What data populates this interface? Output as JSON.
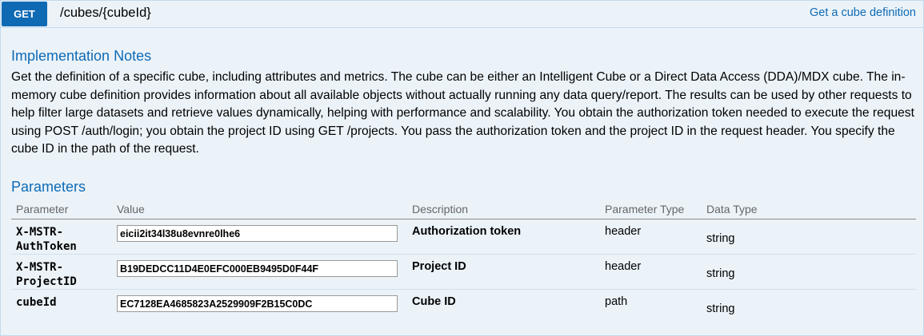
{
  "endpoint": {
    "method": "GET",
    "path": "/cubes/{cubeId}",
    "summary": "Get a cube definition"
  },
  "implementation_notes": {
    "title": "Implementation Notes",
    "body": "Get the definition of a specific cube, including attributes and metrics. The cube can be either an Intelligent Cube or a Direct Data Access (DDA)/MDX cube. The in-memory cube definition provides information about all available objects without actually running any data query/report. The results can be used by other requests to help filter large datasets and retrieve values dynamically, helping with performance and scalability. You obtain the authorization token needed to execute the request using POST /auth/login; you obtain the project ID using GET /projects. You pass the authorization token and the project ID in the request header. You specify the cube ID in the path of the request."
  },
  "parameters": {
    "title": "Parameters",
    "columns": [
      "Parameter",
      "Value",
      "Description",
      "Parameter Type",
      "Data Type"
    ],
    "rows": [
      {
        "name": "X-MSTR-AuthToken",
        "name_line1": "X-MSTR-",
        "name_line2": "AuthToken",
        "value": "eicii2it34l38u8evnre0lhe6",
        "description": "Authorization token",
        "param_type": "header",
        "data_type": "string"
      },
      {
        "name": "X-MSTR-ProjectID",
        "name_line1": "X-MSTR-",
        "name_line2": "ProjectID",
        "value": "B19DEDCC11D4E0EFC000EB9495D0F44F",
        "description": "Project ID",
        "param_type": "header",
        "data_type": "string"
      },
      {
        "name": "cubeId",
        "name_line1": "cubeId",
        "name_line2": "",
        "value": "EC7128EA4685823A2529909F2B15C0DC",
        "description": "Cube ID",
        "param_type": "path",
        "data_type": "string"
      }
    ]
  },
  "colors": {
    "accent": "#0f6ab4",
    "background": "#ebf3f9",
    "border": "#c3d9ec"
  }
}
